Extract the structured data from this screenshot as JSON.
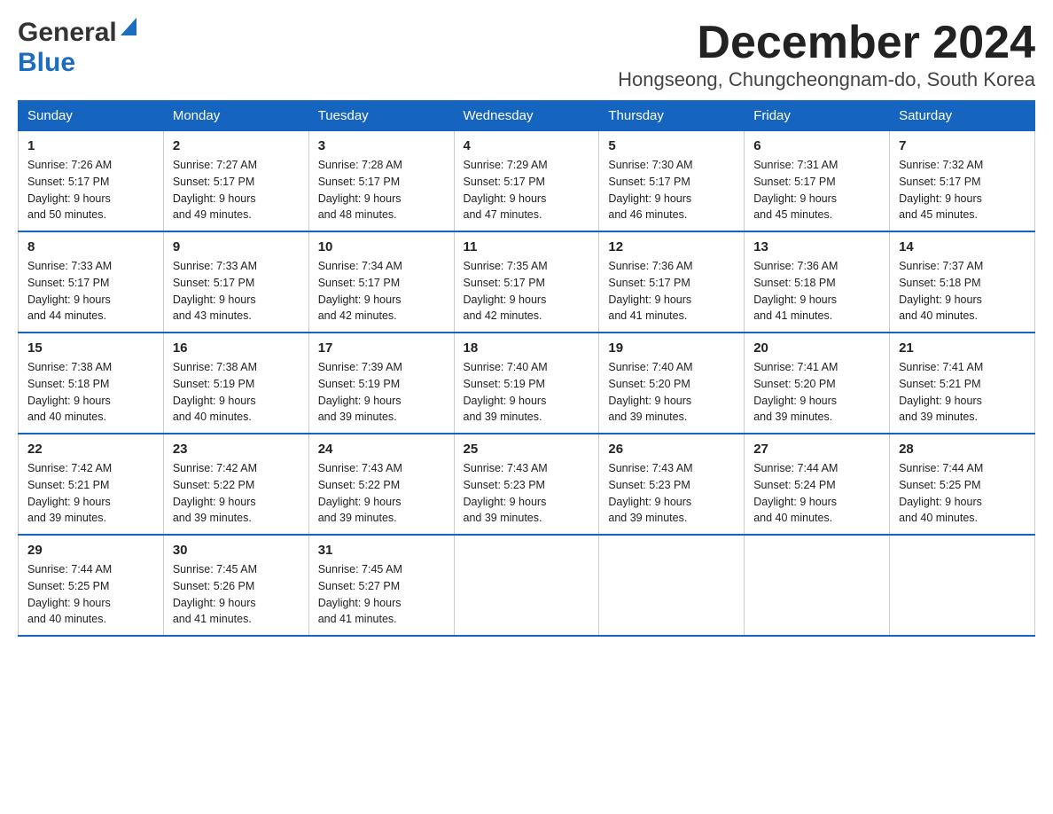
{
  "header": {
    "logo_general": "General",
    "logo_blue": "Blue",
    "month_title": "December 2024",
    "location": "Hongseong, Chungcheongnam-do, South Korea"
  },
  "days_of_week": [
    "Sunday",
    "Monday",
    "Tuesday",
    "Wednesday",
    "Thursday",
    "Friday",
    "Saturday"
  ],
  "weeks": [
    [
      {
        "day": "1",
        "sunrise": "7:26 AM",
        "sunset": "5:17 PM",
        "daylight": "9 hours and 50 minutes."
      },
      {
        "day": "2",
        "sunrise": "7:27 AM",
        "sunset": "5:17 PM",
        "daylight": "9 hours and 49 minutes."
      },
      {
        "day": "3",
        "sunrise": "7:28 AM",
        "sunset": "5:17 PM",
        "daylight": "9 hours and 48 minutes."
      },
      {
        "day": "4",
        "sunrise": "7:29 AM",
        "sunset": "5:17 PM",
        "daylight": "9 hours and 47 minutes."
      },
      {
        "day": "5",
        "sunrise": "7:30 AM",
        "sunset": "5:17 PM",
        "daylight": "9 hours and 46 minutes."
      },
      {
        "day": "6",
        "sunrise": "7:31 AM",
        "sunset": "5:17 PM",
        "daylight": "9 hours and 45 minutes."
      },
      {
        "day": "7",
        "sunrise": "7:32 AM",
        "sunset": "5:17 PM",
        "daylight": "9 hours and 45 minutes."
      }
    ],
    [
      {
        "day": "8",
        "sunrise": "7:33 AM",
        "sunset": "5:17 PM",
        "daylight": "9 hours and 44 minutes."
      },
      {
        "day": "9",
        "sunrise": "7:33 AM",
        "sunset": "5:17 PM",
        "daylight": "9 hours and 43 minutes."
      },
      {
        "day": "10",
        "sunrise": "7:34 AM",
        "sunset": "5:17 PM",
        "daylight": "9 hours and 42 minutes."
      },
      {
        "day": "11",
        "sunrise": "7:35 AM",
        "sunset": "5:17 PM",
        "daylight": "9 hours and 42 minutes."
      },
      {
        "day": "12",
        "sunrise": "7:36 AM",
        "sunset": "5:17 PM",
        "daylight": "9 hours and 41 minutes."
      },
      {
        "day": "13",
        "sunrise": "7:36 AM",
        "sunset": "5:18 PM",
        "daylight": "9 hours and 41 minutes."
      },
      {
        "day": "14",
        "sunrise": "7:37 AM",
        "sunset": "5:18 PM",
        "daylight": "9 hours and 40 minutes."
      }
    ],
    [
      {
        "day": "15",
        "sunrise": "7:38 AM",
        "sunset": "5:18 PM",
        "daylight": "9 hours and 40 minutes."
      },
      {
        "day": "16",
        "sunrise": "7:38 AM",
        "sunset": "5:19 PM",
        "daylight": "9 hours and 40 minutes."
      },
      {
        "day": "17",
        "sunrise": "7:39 AM",
        "sunset": "5:19 PM",
        "daylight": "9 hours and 39 minutes."
      },
      {
        "day": "18",
        "sunrise": "7:40 AM",
        "sunset": "5:19 PM",
        "daylight": "9 hours and 39 minutes."
      },
      {
        "day": "19",
        "sunrise": "7:40 AM",
        "sunset": "5:20 PM",
        "daylight": "9 hours and 39 minutes."
      },
      {
        "day": "20",
        "sunrise": "7:41 AM",
        "sunset": "5:20 PM",
        "daylight": "9 hours and 39 minutes."
      },
      {
        "day": "21",
        "sunrise": "7:41 AM",
        "sunset": "5:21 PM",
        "daylight": "9 hours and 39 minutes."
      }
    ],
    [
      {
        "day": "22",
        "sunrise": "7:42 AM",
        "sunset": "5:21 PM",
        "daylight": "9 hours and 39 minutes."
      },
      {
        "day": "23",
        "sunrise": "7:42 AM",
        "sunset": "5:22 PM",
        "daylight": "9 hours and 39 minutes."
      },
      {
        "day": "24",
        "sunrise": "7:43 AM",
        "sunset": "5:22 PM",
        "daylight": "9 hours and 39 minutes."
      },
      {
        "day": "25",
        "sunrise": "7:43 AM",
        "sunset": "5:23 PM",
        "daylight": "9 hours and 39 minutes."
      },
      {
        "day": "26",
        "sunrise": "7:43 AM",
        "sunset": "5:23 PM",
        "daylight": "9 hours and 39 minutes."
      },
      {
        "day": "27",
        "sunrise": "7:44 AM",
        "sunset": "5:24 PM",
        "daylight": "9 hours and 40 minutes."
      },
      {
        "day": "28",
        "sunrise": "7:44 AM",
        "sunset": "5:25 PM",
        "daylight": "9 hours and 40 minutes."
      }
    ],
    [
      {
        "day": "29",
        "sunrise": "7:44 AM",
        "sunset": "5:25 PM",
        "daylight": "9 hours and 40 minutes."
      },
      {
        "day": "30",
        "sunrise": "7:45 AM",
        "sunset": "5:26 PM",
        "daylight": "9 hours and 41 minutes."
      },
      {
        "day": "31",
        "sunrise": "7:45 AM",
        "sunset": "5:27 PM",
        "daylight": "9 hours and 41 minutes."
      },
      null,
      null,
      null,
      null
    ]
  ]
}
